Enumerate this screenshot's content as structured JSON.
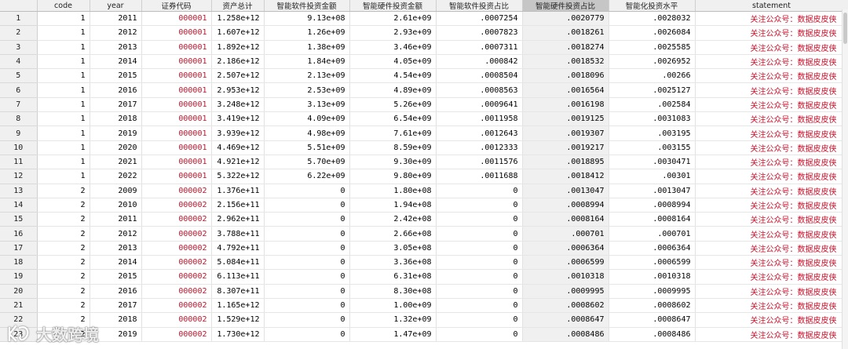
{
  "columns": [
    "code",
    "year",
    "证券代码",
    "资产总计",
    "智能软件投资金额",
    "智能硬件投资金额",
    "智能软件投资占比",
    "智能硬件投资占比",
    "智能化投资水平",
    "statement"
  ],
  "selected_column": "智能硬件投资占比",
  "rows": [
    [
      "1",
      "1",
      "2011",
      "000001",
      "1.258e+12",
      "9.13e+08",
      "2.61e+09",
      ".0007254",
      ".0020779",
      ".0028032",
      "关注公众号：数据皮皮侠"
    ],
    [
      "2",
      "1",
      "2012",
      "000001",
      "1.607e+12",
      "1.26e+09",
      "2.93e+09",
      ".0007823",
      ".0018261",
      ".0026084",
      "关注公众号：数据皮皮侠"
    ],
    [
      "3",
      "1",
      "2013",
      "000001",
      "1.892e+12",
      "1.38e+09",
      "3.46e+09",
      ".0007311",
      ".0018274",
      ".0025585",
      "关注公众号：数据皮皮侠"
    ],
    [
      "4",
      "1",
      "2014",
      "000001",
      "2.186e+12",
      "1.84e+09",
      "4.05e+09",
      ".000842",
      ".0018532",
      ".0026952",
      "关注公众号：数据皮皮侠"
    ],
    [
      "5",
      "1",
      "2015",
      "000001",
      "2.507e+12",
      "2.13e+09",
      "4.54e+09",
      ".0008504",
      ".0018096",
      ".00266",
      "关注公众号：数据皮皮侠"
    ],
    [
      "6",
      "1",
      "2016",
      "000001",
      "2.953e+12",
      "2.53e+09",
      "4.89e+09",
      ".0008563",
      ".0016564",
      ".0025127",
      "关注公众号：数据皮皮侠"
    ],
    [
      "7",
      "1",
      "2017",
      "000001",
      "3.248e+12",
      "3.13e+09",
      "5.26e+09",
      ".0009641",
      ".0016198",
      ".002584",
      "关注公众号：数据皮皮侠"
    ],
    [
      "8",
      "1",
      "2018",
      "000001",
      "3.419e+12",
      "4.09e+09",
      "6.54e+09",
      ".0011958",
      ".0019125",
      ".0031083",
      "关注公众号：数据皮皮侠"
    ],
    [
      "9",
      "1",
      "2019",
      "000001",
      "3.939e+12",
      "4.98e+09",
      "7.61e+09",
      ".0012643",
      ".0019307",
      ".003195",
      "关注公众号：数据皮皮侠"
    ],
    [
      "10",
      "1",
      "2020",
      "000001",
      "4.469e+12",
      "5.51e+09",
      "8.59e+09",
      ".0012333",
      ".0019217",
      ".003155",
      "关注公众号：数据皮皮侠"
    ],
    [
      "11",
      "1",
      "2021",
      "000001",
      "4.921e+12",
      "5.70e+09",
      "9.30e+09",
      ".0011576",
      ".0018895",
      ".0030471",
      "关注公众号：数据皮皮侠"
    ],
    [
      "12",
      "1",
      "2022",
      "000001",
      "5.322e+12",
      "6.22e+09",
      "9.80e+09",
      ".0011688",
      ".0018412",
      ".00301",
      "关注公众号：数据皮皮侠"
    ],
    [
      "13",
      "2",
      "2009",
      "000002",
      "1.376e+11",
      "0",
      "1.80e+08",
      "0",
      ".0013047",
      ".0013047",
      "关注公众号：数据皮皮侠"
    ],
    [
      "14",
      "2",
      "2010",
      "000002",
      "2.156e+11",
      "0",
      "1.94e+08",
      "0",
      ".0008994",
      ".0008994",
      "关注公众号：数据皮皮侠"
    ],
    [
      "15",
      "2",
      "2011",
      "000002",
      "2.962e+11",
      "0",
      "2.42e+08",
      "0",
      ".0008164",
      ".0008164",
      "关注公众号：数据皮皮侠"
    ],
    [
      "16",
      "2",
      "2012",
      "000002",
      "3.788e+11",
      "0",
      "2.66e+08",
      "0",
      ".000701",
      ".000701",
      "关注公众号：数据皮皮侠"
    ],
    [
      "17",
      "2",
      "2013",
      "000002",
      "4.792e+11",
      "0",
      "3.05e+08",
      "0",
      ".0006364",
      ".0006364",
      "关注公众号：数据皮皮侠"
    ],
    [
      "18",
      "2",
      "2014",
      "000002",
      "5.084e+11",
      "0",
      "3.36e+08",
      "0",
      ".0006599",
      ".0006599",
      "关注公众号：数据皮皮侠"
    ],
    [
      "19",
      "2",
      "2015",
      "000002",
      "6.113e+11",
      "0",
      "6.31e+08",
      "0",
      ".0010318",
      ".0010318",
      "关注公众号：数据皮皮侠"
    ],
    [
      "20",
      "2",
      "2016",
      "000002",
      "8.307e+11",
      "0",
      "8.30e+08",
      "0",
      ".0009995",
      ".0009995",
      "关注公众号：数据皮皮侠"
    ],
    [
      "21",
      "2",
      "2017",
      "000002",
      "1.165e+12",
      "0",
      "1.00e+09",
      "0",
      ".0008602",
      ".0008602",
      "关注公众号：数据皮皮侠"
    ],
    [
      "22",
      "2",
      "2018",
      "000002",
      "1.529e+12",
      "0",
      "1.32e+09",
      "0",
      ".0008647",
      ".0008647",
      "关注公众号：数据皮皮侠"
    ],
    [
      "23",
      "2",
      "2019",
      "000002",
      "1.730e+12",
      "0",
      "1.47e+09",
      "0",
      ".0008486",
      ".0008486",
      "关注公众号：数据皮皮侠"
    ]
  ],
  "watermark": {
    "text": "大数跨境",
    "icon": "brand-logo-icon"
  },
  "colors": {
    "code_text": "#c0142a",
    "statement_text": "#d0102a",
    "selected_column_bg": "#c6c6c6"
  }
}
